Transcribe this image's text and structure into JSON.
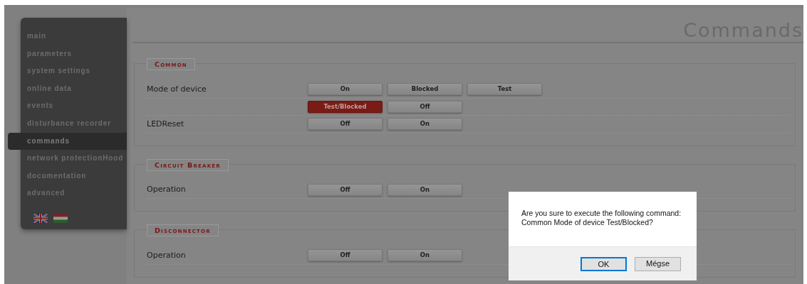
{
  "sidebar": {
    "items": [
      {
        "label": "main",
        "selected": false
      },
      {
        "label": "parameters",
        "selected": false
      },
      {
        "label": "system settings",
        "selected": false
      },
      {
        "label": "online data",
        "selected": false
      },
      {
        "label": "events",
        "selected": false
      },
      {
        "label": "disturbance recorder",
        "selected": false
      },
      {
        "label": "commands",
        "selected": true
      },
      {
        "label": "network protectionHood",
        "selected": false
      },
      {
        "label": "documentation",
        "selected": false
      },
      {
        "label": "advanced",
        "selected": false
      }
    ],
    "languages": [
      {
        "kind": "uk"
      },
      {
        "kind": "hu"
      }
    ]
  },
  "page_title": "Commands",
  "sections": [
    {
      "title": "Common",
      "rows": [
        {
          "label": "Mode of device",
          "buttons": [
            {
              "label": "On",
              "active": false
            },
            {
              "label": "Blocked",
              "active": false
            },
            {
              "label": "Test",
              "active": false
            }
          ]
        },
        {
          "buttons": [
            {
              "label": "Test/Blocked",
              "active": true
            },
            {
              "label": "Off",
              "active": false
            }
          ]
        },
        {
          "label": "LEDReset",
          "buttons": [
            {
              "label": "Off",
              "active": false
            },
            {
              "label": "On",
              "active": false
            }
          ]
        }
      ]
    },
    {
      "title": "Circuit Breaker",
      "rows": [
        {
          "label": "Operation",
          "buttons": [
            {
              "label": "Off",
              "active": false
            },
            {
              "label": "On",
              "active": false
            }
          ]
        }
      ]
    },
    {
      "title": "Disconnector",
      "rows": [
        {
          "label": "Operation",
          "buttons": [
            {
              "label": "Off",
              "active": false
            },
            {
              "label": "On",
              "active": false
            }
          ]
        }
      ]
    }
  ],
  "dialog": {
    "message": "Are you sure to execute the following command:\nCommon Mode of device Test/Blocked?",
    "buttons": [
      {
        "label": "OK",
        "focused": true
      },
      {
        "label": "Mégse",
        "focused": false
      }
    ]
  }
}
